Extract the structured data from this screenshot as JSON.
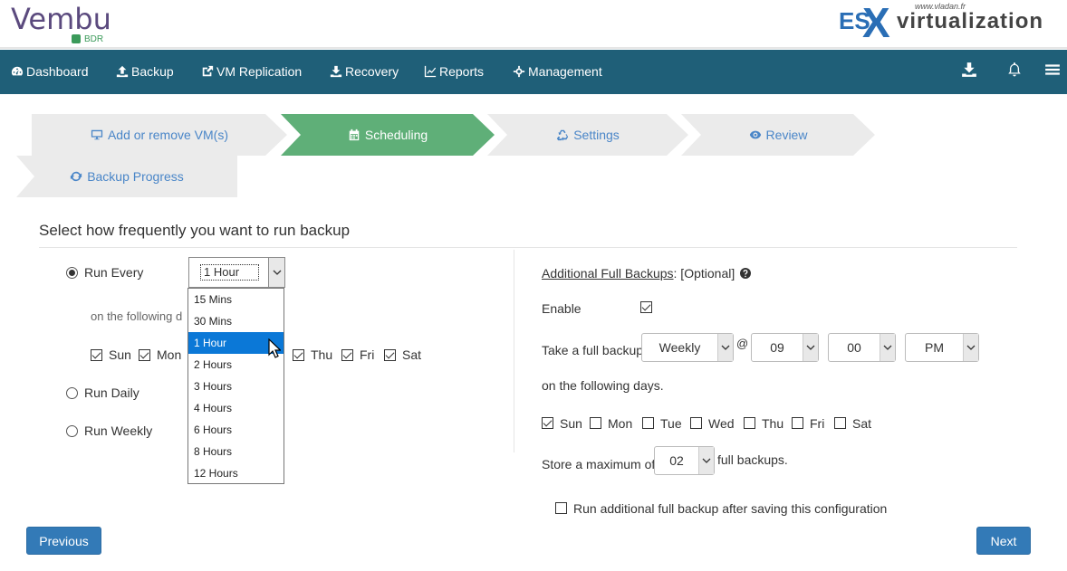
{
  "header": {
    "logo_name": "Vembu",
    "logo_sub": "BDR",
    "watermark_url": "www.vladan.fr",
    "watermark_es": "ES",
    "watermark_x": "X",
    "watermark_rest": "virtualization"
  },
  "nav": {
    "items": [
      {
        "label": "Dashboard",
        "icon": "tachometer-icon"
      },
      {
        "label": "Backup",
        "icon": "upload-icon"
      },
      {
        "label": "VM Replication",
        "icon": "share-icon"
      },
      {
        "label": "Recovery",
        "icon": "download-icon"
      },
      {
        "label": "Reports",
        "icon": "chart-line-icon"
      },
      {
        "label": "Management",
        "icon": "crosshair-icon"
      }
    ],
    "right_icons": [
      "download-tray-icon",
      "bell-icon",
      "hamburger-menu-icon"
    ]
  },
  "wizard": {
    "steps": [
      {
        "label": "Add or remove VM(s)",
        "icon": "monitor-icon",
        "active": false
      },
      {
        "label": "Scheduling",
        "icon": "calendar-icon",
        "active": true
      },
      {
        "label": "Settings",
        "icon": "recycle-icon",
        "active": false
      },
      {
        "label": "Review",
        "icon": "eye-icon",
        "active": false
      },
      {
        "label": "Backup Progress",
        "icon": "refresh-icon",
        "active": false
      }
    ]
  },
  "schedule": {
    "title": "Select how frequently you want to run backup",
    "run_every_label": "Run Every",
    "run_every_value": "1 Hour",
    "following_days_label": "on the following d",
    "days": [
      {
        "label": "Sun",
        "checked": true
      },
      {
        "label": "Mon",
        "checked": true
      },
      {
        "label": "Thu",
        "checked": true
      },
      {
        "label": "Fri",
        "checked": true
      },
      {
        "label": "Sat",
        "checked": true
      }
    ],
    "run_daily_label": "Run Daily",
    "run_weekly_label": "Run Weekly",
    "dropdown_options": [
      "15 Mins",
      "30 Mins",
      "1 Hour",
      "2 Hours",
      "3 Hours",
      "4 Hours",
      "6 Hours",
      "8 Hours",
      "12 Hours"
    ],
    "dropdown_selected": "1 Hour"
  },
  "full_backups": {
    "title": "Additional Full Backups",
    "optional": ": [Optional]",
    "enable_label": "Enable",
    "enable_checked": true,
    "take_label": "Take a full backup",
    "frequency": "Weekly",
    "at": "@",
    "hour": "09",
    "minute": "00",
    "ampm": "PM",
    "following_days_label": "on the following days.",
    "days": [
      {
        "label": "Sun",
        "checked": true
      },
      {
        "label": "Mon",
        "checked": false
      },
      {
        "label": "Tue",
        "checked": false
      },
      {
        "label": "Wed",
        "checked": false
      },
      {
        "label": "Thu",
        "checked": false
      },
      {
        "label": "Fri",
        "checked": false
      },
      {
        "label": "Sat",
        "checked": false
      }
    ],
    "store_label": "Store a maximum of",
    "store_value": "02",
    "store_suffix": "full backups.",
    "run_additional_label": "Run additional full backup after saving this configuration"
  },
  "buttons": {
    "previous": "Previous",
    "next": "Next"
  }
}
